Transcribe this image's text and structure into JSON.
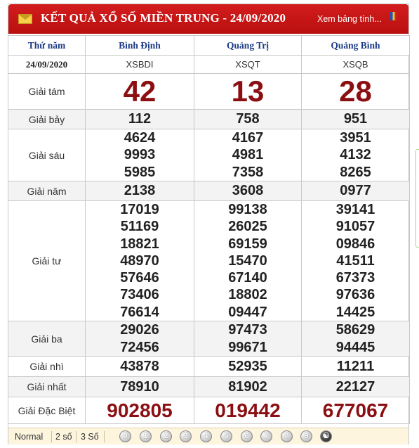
{
  "header": {
    "title": "KẾT QUẢ XỔ SỐ MIỀN TRUNG - 24/09/2020",
    "more_link": "Xem bảng tính..."
  },
  "columns": {
    "day": "Thứ năm",
    "date": "24/09/2020",
    "provinces": [
      {
        "name": "Bình Định",
        "code": "XSBDI"
      },
      {
        "name": "Quảng Trị",
        "code": "XSQT"
      },
      {
        "name": "Quảng Bình",
        "code": "XSQB"
      }
    ]
  },
  "prizes": {
    "g8": {
      "label": "Giải tám",
      "values": [
        "42",
        "13",
        "28"
      ]
    },
    "g7": {
      "label": "Giải bảy",
      "values": [
        "112",
        "758",
        "951"
      ]
    },
    "g6": {
      "label": "Giải sáu",
      "values": [
        [
          "4624",
          "9993",
          "5985"
        ],
        [
          "4167",
          "4981",
          "7358"
        ],
        [
          "3951",
          "4132",
          "8265"
        ]
      ]
    },
    "g5": {
      "label": "Giải năm",
      "values": [
        "2138",
        "3608",
        "0977"
      ]
    },
    "g4": {
      "label": "Giải tư",
      "values": [
        [
          "17019",
          "51169",
          "18821",
          "48970",
          "57646",
          "73406",
          "76614"
        ],
        [
          "99138",
          "26025",
          "69159",
          "15470",
          "67140",
          "18802",
          "09447"
        ],
        [
          "39141",
          "91057",
          "09846",
          "41511",
          "67373",
          "97636",
          "14425"
        ]
      ]
    },
    "g3": {
      "label": "Giải ba",
      "values": [
        [
          "29026",
          "72456"
        ],
        [
          "97473",
          "99671"
        ],
        [
          "58629",
          "94445"
        ]
      ]
    },
    "g2": {
      "label": "Giải nhì",
      "values": [
        "43878",
        "52935",
        "11211"
      ]
    },
    "g1": {
      "label": "Giải nhất",
      "values": [
        "78910",
        "81902",
        "22127"
      ]
    },
    "db": {
      "label": "Giải Đặc Biệt",
      "values": [
        "902805",
        "019442",
        "677067"
      ]
    }
  },
  "footer": {
    "modes": [
      "Normal",
      "2 số",
      "3 Số"
    ],
    "digits": [
      "0",
      "1",
      "2",
      "3",
      "4",
      "5",
      "6",
      "7",
      "8",
      "9"
    ]
  },
  "colors": {
    "header_red": "#c01414",
    "prize_red": "#8b0f12",
    "province_blue": "#1b3a86"
  }
}
